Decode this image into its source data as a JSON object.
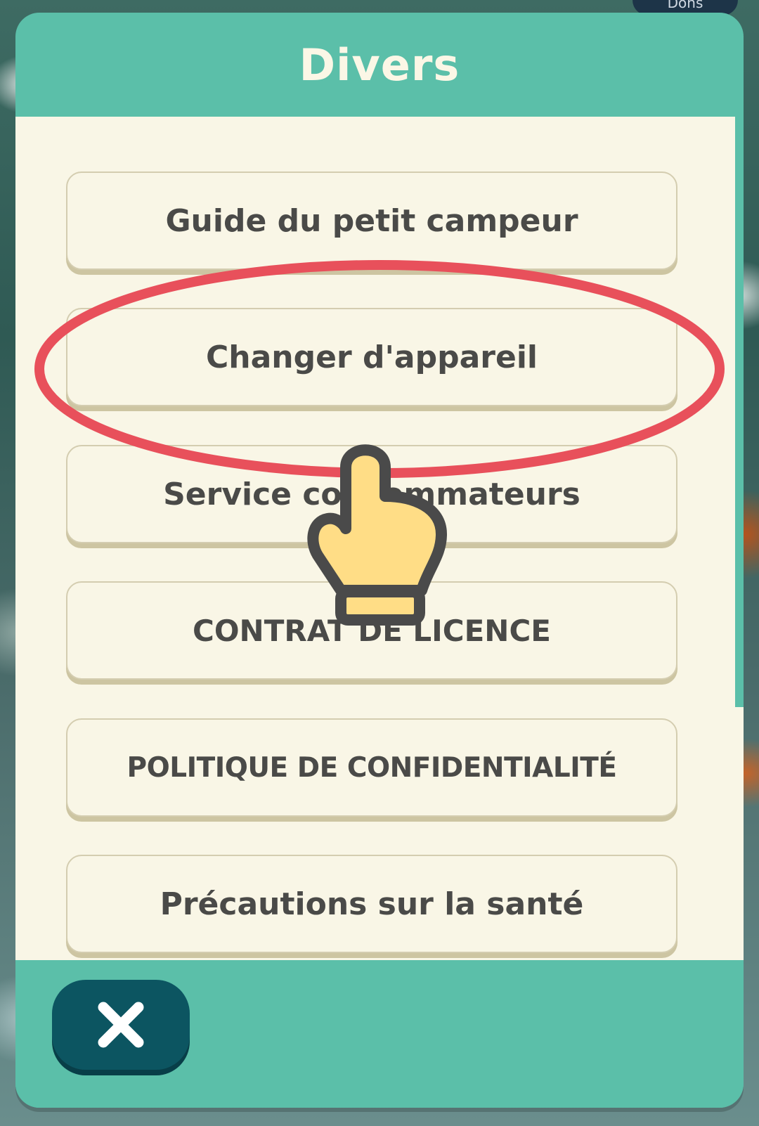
{
  "background": {
    "top_badge_label": "Dons"
  },
  "dialog": {
    "title": "Divers",
    "menu_items": [
      {
        "label": "Guide du petit campeur"
      },
      {
        "label": "Changer d'appareil"
      },
      {
        "label": "Service consommateurs"
      },
      {
        "label": "CONTRAT DE LICENCE"
      },
      {
        "label": "POLITIQUE DE CONFIDENTIALITÉ"
      },
      {
        "label": "Précautions sur la santé"
      }
    ],
    "close_icon": "close-icon"
  },
  "annotation": {
    "highlighted_item": "Changer d'appareil",
    "highlight_color": "#e8505b",
    "pointer_icon": "pointing-hand-icon",
    "pointer_color": "#ffdd86"
  },
  "colors": {
    "accent": "#5bbfa9",
    "panel": "#f9f6e6",
    "text": "#4a4a48",
    "close_button": "#0c5561"
  }
}
